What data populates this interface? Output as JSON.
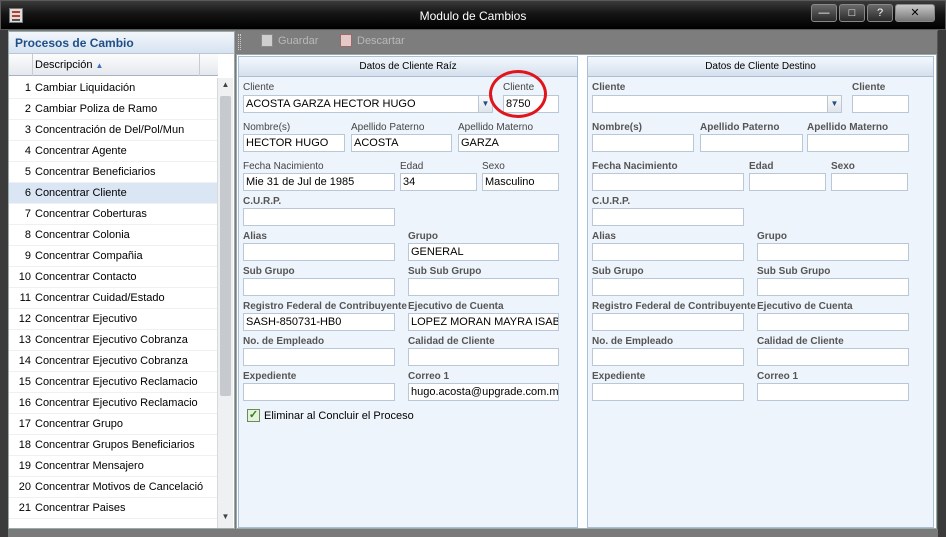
{
  "window": {
    "title": "Modulo de Cambios",
    "btn_minimize": "—",
    "btn_maximize": "□",
    "btn_help": "?",
    "btn_close": "✕"
  },
  "left_panel": {
    "title": "Procesos de Cambio",
    "column_header": "Descripción",
    "sort_icon": "sort-asc-icon",
    "rows": [
      {
        "n": "1",
        "label": "Cambiar Liquidación"
      },
      {
        "n": "2",
        "label": "Cambiar Poliza de Ramo"
      },
      {
        "n": "3",
        "label": "Concentración de Del/Pol/Mun"
      },
      {
        "n": "4",
        "label": "Concentrar Agente"
      },
      {
        "n": "5",
        "label": "Concentrar Beneficiarios"
      },
      {
        "n": "6",
        "label": "Concentrar Cliente"
      },
      {
        "n": "7",
        "label": "Concentrar Coberturas"
      },
      {
        "n": "8",
        "label": "Concentrar Colonia"
      },
      {
        "n": "9",
        "label": "Concentrar Compañia"
      },
      {
        "n": "10",
        "label": "Concentrar Contacto"
      },
      {
        "n": "11",
        "label": "Concentrar Cuidad/Estado"
      },
      {
        "n": "12",
        "label": "Concentrar Ejecutivo"
      },
      {
        "n": "13",
        "label": "Concentrar Ejecutivo Cobranza"
      },
      {
        "n": "14",
        "label": "Concentrar Ejecutivo Cobranza"
      },
      {
        "n": "15",
        "label": "Concentrar Ejecutivo Reclamacio"
      },
      {
        "n": "16",
        "label": "Concentrar Ejecutivo Reclamacio"
      },
      {
        "n": "17",
        "label": "Concentrar Grupo"
      },
      {
        "n": "18",
        "label": "Concentrar Grupos Beneficiarios"
      },
      {
        "n": "19",
        "label": "Concentrar Mensajero"
      },
      {
        "n": "20",
        "label": "Concentrar Motivos de Cancelació"
      },
      {
        "n": "21",
        "label": "Concentrar Paises"
      }
    ]
  },
  "toolbar": {
    "save_label": "Guardar",
    "discard_label": "Descartar"
  },
  "source": {
    "title": "Datos de Cliente Raíz",
    "cliente_label": "Cliente",
    "cliente_value": "ACOSTA GARZA HECTOR HUGO",
    "cliente_id_label": "Cliente",
    "cliente_id_value": "8750",
    "nombres_label": "Nombre(s)",
    "nombres_value": "HECTOR HUGO",
    "ap_paterno_label": "Apellido Paterno",
    "ap_paterno_value": "ACOSTA",
    "ap_materno_label": "Apellido Materno",
    "ap_materno_value": "GARZA",
    "fecha_label": "Fecha Nacimiento",
    "fecha_value": "Mie 31 de Jul de 1985",
    "edad_label": "Edad",
    "edad_value": "34",
    "sexo_label": "Sexo",
    "sexo_value": "Masculino",
    "curp_label": "C.U.R.P.",
    "curp_value": "",
    "alias_label": "Alias",
    "alias_value": "",
    "grupo_label": "Grupo",
    "grupo_value": "GENERAL",
    "subgrupo_label": "Sub Grupo",
    "subgrupo_value": "",
    "subsubgrupo_label": "Sub Sub Grupo",
    "subsubgrupo_value": "",
    "rfc_label": "Registro Federal de Contribuyente",
    "rfc_value": "SASH-850731-HB0",
    "ejecutivo_label": "Ejecutivo de Cuenta",
    "ejecutivo_value": "LOPEZ MORAN MAYRA ISABEL",
    "empleado_label": "No. de Empleado",
    "empleado_value": "",
    "calidad_label": "Calidad de Cliente",
    "calidad_value": "",
    "expediente_label": "Expediente",
    "expediente_value": "",
    "correo_label": "Correo 1",
    "correo_value": "hugo.acosta@upgrade.com.mx",
    "eliminar_label": "Eliminar al Concluir el Proceso"
  },
  "target": {
    "title": "Datos de Cliente Destino",
    "cliente_label": "Cliente",
    "cliente_id_label": "Cliente",
    "nombres_label": "Nombre(s)",
    "ap_paterno_label": "Apellido Paterno",
    "ap_materno_label": "Apellido Materno",
    "fecha_label": "Fecha Nacimiento",
    "edad_label": "Edad",
    "sexo_label": "Sexo",
    "curp_label": "C.U.R.P.",
    "alias_label": "Alias",
    "grupo_label": "Grupo",
    "subgrupo_label": "Sub Grupo",
    "subsubgrupo_label": "Sub Sub Grupo",
    "rfc_label": "Registro Federal de Contribuyente",
    "ejecutivo_label": "Ejecutivo de Cuenta",
    "empleado_label": "No. de Empleado",
    "calidad_label": "Calidad de Cliente",
    "expediente_label": "Expediente",
    "correo_label": "Correo 1"
  },
  "colors": {
    "accent": "#1f4f87",
    "annotation": "#e0141a",
    "selected_row": "#dbe6f4"
  }
}
